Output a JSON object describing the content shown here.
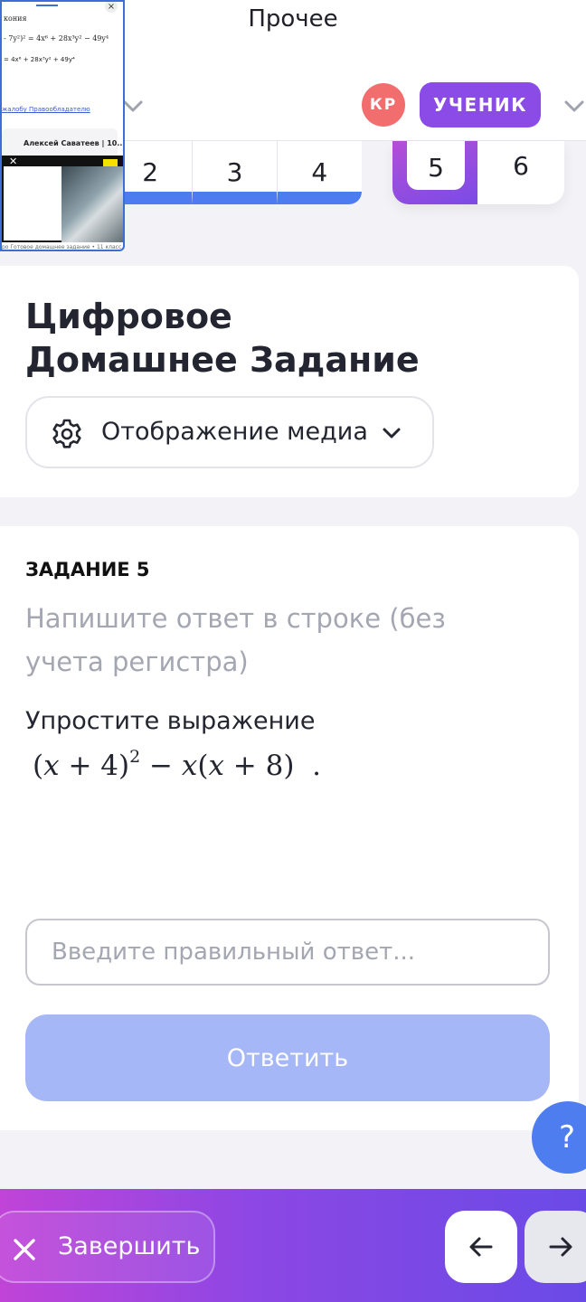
{
  "header": {
    "title": "Прочее",
    "avatar_initials": "КР",
    "role_badge": "УЧЕНИК"
  },
  "task_tabs": {
    "left": [
      "2",
      "3",
      "4"
    ],
    "active": "5",
    "next": "6"
  },
  "popup": {
    "line1": "кония",
    "line2": "- 7y²)² = 4x⁶ + 28x³y² − 49y⁴",
    "line3": "= 4x⁶ + 28x³y² + 49y⁴",
    "link": "жалобу Правообладателю",
    "card_title": "Алексей Саватеев | 10...",
    "close": "×",
    "footer": "ро Готовое домашнее задание • 11 класс"
  },
  "title_card": {
    "title": "Цифровое Домашнее Задание",
    "media_label": "Отображение медиа"
  },
  "task": {
    "label": "ЗАДАНИЕ 5",
    "instruction": "Напишите ответ в строке (без учета регистра)",
    "question": "Упростите выражение",
    "input_placeholder": "Введите правильный ответ...",
    "submit_label": "Ответить"
  },
  "help": {
    "label": "?"
  },
  "footer": {
    "finish_label": "Завершить"
  },
  "colors": {
    "accent": "#4d7cf0",
    "badge": "#8a4be6",
    "avatar": "#f26d6d",
    "submit_disabled": "#a6b7f8"
  },
  "icons": {
    "gear": "gear-icon",
    "chevron": "chevron-down-icon",
    "close": "close-icon",
    "arrow_left": "arrow-left-icon",
    "arrow_right": "arrow-right-icon"
  }
}
